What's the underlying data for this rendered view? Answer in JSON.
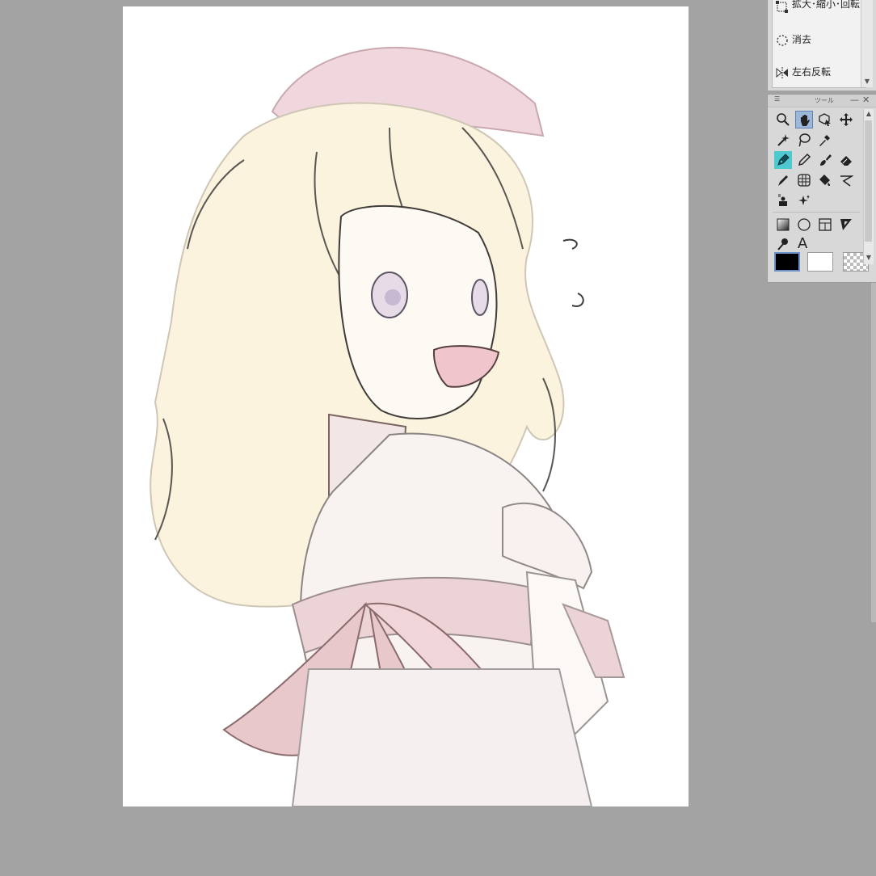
{
  "subtool_panel": {
    "items": [
      {
        "label": "拡大･縮小･回転",
        "icon": "transform-icon"
      },
      {
        "label": "消去",
        "icon": "clear-icon"
      },
      {
        "label": "左右反転",
        "icon": "flip-horizontal-icon"
      }
    ]
  },
  "tool_panel": {
    "title": "ツール",
    "tools": [
      {
        "icon": "zoom-icon",
        "active": false
      },
      {
        "icon": "hand-icon",
        "active": true
      },
      {
        "icon": "object-select-icon",
        "active": false
      },
      {
        "icon": "move-icon",
        "active": false
      },
      {
        "icon": "magic-wand-icon",
        "active": false
      },
      {
        "icon": "lasso-icon",
        "active": false
      },
      {
        "icon": "eyedropper-icon",
        "active": false
      },
      {
        "icon": "pen-icon",
        "active": false
      },
      {
        "icon": "pencil-icon",
        "active": false
      },
      {
        "icon": "brush-icon",
        "active": false
      },
      {
        "icon": "eraser-icon",
        "active": false
      },
      {
        "icon": "blend-icon",
        "active": false
      },
      {
        "icon": "mesh-icon",
        "active": false
      },
      {
        "icon": "fill-icon",
        "active": false
      },
      {
        "icon": "curve-icon",
        "active": false
      },
      {
        "icon": "figure-icon",
        "active": false
      },
      {
        "icon": "sparkle-icon",
        "active": false
      },
      {
        "icon": "gradient-icon",
        "active": false
      },
      {
        "icon": "ellipse-icon",
        "active": false
      },
      {
        "icon": "frame-icon",
        "active": false
      },
      {
        "icon": "ruler-icon",
        "active": false
      },
      {
        "icon": "correction-icon",
        "active": false
      },
      {
        "icon": "text-icon",
        "active": false
      }
    ],
    "text_tool_glyph": "A",
    "colors": {
      "main": "#000000",
      "sub": "#ffffff",
      "transparent": "checker"
    }
  },
  "canvas": {
    "background": "#ffffff",
    "workspace": "#a3a3a3"
  }
}
